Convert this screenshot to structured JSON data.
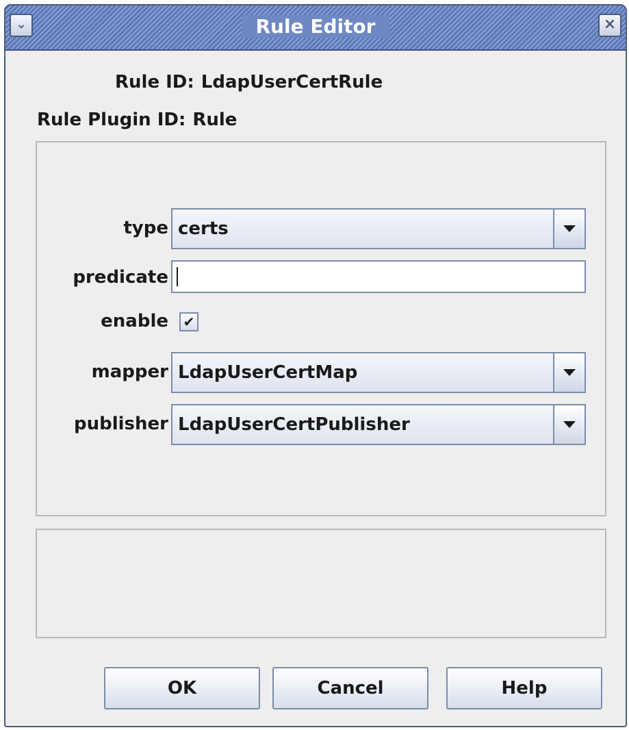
{
  "window": {
    "title": "Rule Editor",
    "menu_icon": "chevron-down-icon",
    "close_icon": "close-icon"
  },
  "info": {
    "rule_id_label": "Rule ID:",
    "rule_id_value": "LdapUserCertRule",
    "plugin_id_label": "Rule Plugin ID:",
    "plugin_id_value": "Rule"
  },
  "form": {
    "type": {
      "label": "type",
      "value": "certs"
    },
    "predicate": {
      "label": "predicate",
      "value": ""
    },
    "enable": {
      "label": "enable",
      "checked": true,
      "check_glyph": "✔"
    },
    "mapper": {
      "label": "mapper",
      "value": "LdapUserCertMap"
    },
    "publisher": {
      "label": "publisher",
      "value": "LdapUserCertPublisher"
    }
  },
  "buttons": {
    "ok": "OK",
    "cancel": "Cancel",
    "help": "Help"
  },
  "colors": {
    "titlebar": "#6e88c4",
    "window_bg": "#eeeeee",
    "control_border": "#7b8cab"
  }
}
